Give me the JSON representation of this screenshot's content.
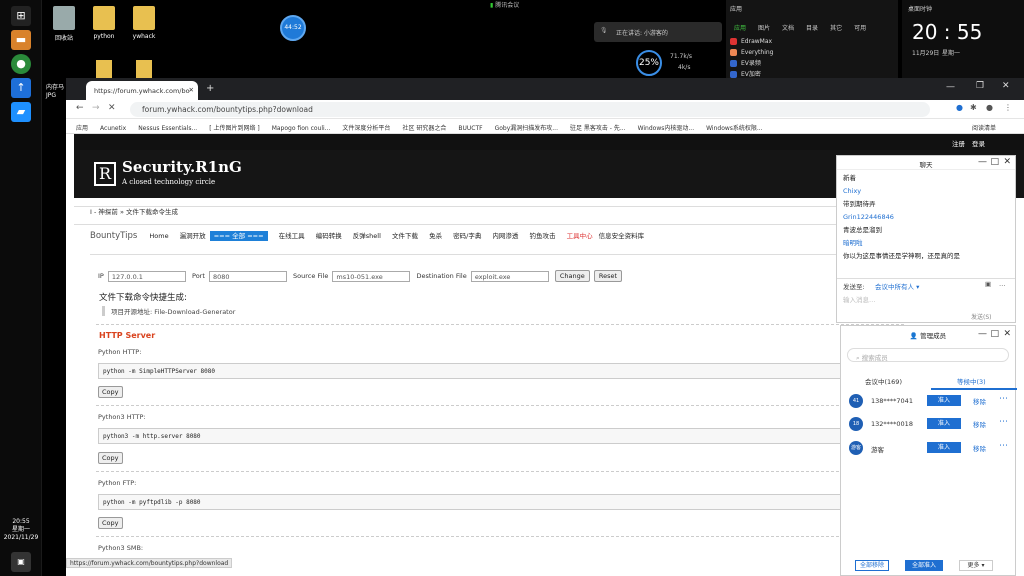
{
  "desktop": {
    "icons": [
      {
        "label": "回收站"
      },
      {
        "label": "python"
      },
      {
        "label": "ywhack"
      }
    ],
    "meeting_status": "腾讯会议",
    "clock_bubble": "44:52",
    "voice_status": "正在讲话: 小游客的",
    "network": {
      "percent": "25%",
      "up": "71.7k/s",
      "down": "4k/s"
    },
    "taskbar_time": "20:55",
    "taskbar_day": "星期一",
    "taskbar_date": "2021/11/29",
    "left_label": "内存马",
    "left_label2": "JPG"
  },
  "apps_panel": {
    "title": "应用",
    "tabs": [
      "应用",
      "图片",
      "文档",
      "目录",
      "其它",
      "可用"
    ],
    "items": [
      "EdrawMax",
      "Everything",
      "EV录频",
      "EV加密"
    ]
  },
  "big_clock": {
    "title": "桌面时钟",
    "time": "20 : 55",
    "date": "11月29日",
    "weekday": "星期一"
  },
  "browser": {
    "tab_title": "https://forum.ywhack.com/bo",
    "url": "forum.ywhack.com/bountytips.php?download",
    "bookmarks": [
      "应用",
      "Acunetix",
      "Nessus Essentials...",
      "[ 上传图片到网络 ]",
      "Mapogo fion couli...",
      "文件深度分析平台",
      "社区 研究器之合",
      "BUUCTF",
      "Goby漏洞扫描发布攻...",
      "驻足 黑客攻击 - 先...",
      "Windows内核驱动...",
      "Windows系统权限..."
    ],
    "reading_list": "阅读清单",
    "status_url": "https://forum.ywhack.com/bountytips.php?download"
  },
  "site": {
    "top_links": [
      "注册",
      "登录"
    ],
    "logo_letter": "R",
    "name": "Security.R1nG",
    "tagline": "A closed technology circle",
    "breadcrumb": "I - 神探前 » 文件下载命令生成",
    "nav_logo": "BountyTips",
    "nav_items": [
      "Home",
      "漏洞开放",
      "=== 全部 ===",
      "在线工具",
      "编码转换",
      "反弹shell",
      "文件下载",
      "免杀",
      "密码/字典",
      "内网渗透",
      "钓鱼攻击",
      "工具中心",
      "信息安全资料库"
    ],
    "form": {
      "ip_label": "IP",
      "ip_value": "127.0.0.1",
      "port_label": "Port",
      "port_value": "8080",
      "src_label": "Source File",
      "src_value": "ms10-051.exe",
      "dst_label": "Destination File",
      "dst_value": "exploit.exe",
      "change": "Change",
      "reset": "Reset"
    },
    "gen_title": "文件下载命令快捷生成:",
    "proj_addr": "项目开源地址: File-Download-Generator",
    "section": "HTTP Server",
    "blocks": [
      {
        "label": "Python HTTP:",
        "code": "python -m SimpleHTTPServer 8080"
      },
      {
        "label": "Python3 HTTP:",
        "code": "python3 -m http.server 8080"
      },
      {
        "label": "Python FTP:",
        "code": "python -m pyftpdlib -p 8080"
      }
    ],
    "next_label": "Python3 SMB:",
    "copy": "Copy"
  },
  "chat": {
    "title": "聊天",
    "messages": [
      {
        "text": "新着",
        "blue": false
      },
      {
        "text": "Chixy",
        "blue": true
      },
      {
        "text": "带到期待弄",
        "blue": false
      },
      {
        "text": "Grin122446846",
        "blue": true
      },
      {
        "text": "青波总是溜到",
        "blue": false
      },
      {
        "text": "暗明啦",
        "blue": true
      },
      {
        "text": "你以为这是事情还是学神啊，还是真的是",
        "blue": false
      }
    ],
    "send_to_label": "发送至:",
    "send_to_value": "会议中所有人 ▾",
    "input_placeholder": "输入消息…",
    "send_btn": "发送(S)"
  },
  "members": {
    "title": "管理成员",
    "search_placeholder": "搜索成员",
    "tab_in": "会议中(169)",
    "tab_wait": "等候中(3)",
    "rows": [
      {
        "avatar": "41",
        "id": "138****7041",
        "action": "准入",
        "remove": "移除"
      },
      {
        "avatar": "18",
        "id": "132****0018",
        "action": "准入",
        "remove": "移除"
      },
      {
        "avatar": "游客",
        "id": "游客",
        "action": "准入",
        "remove": "移除"
      }
    ],
    "remove_all": "全部移除",
    "admit_all": "全部准入",
    "more": "更多 ▾"
  }
}
